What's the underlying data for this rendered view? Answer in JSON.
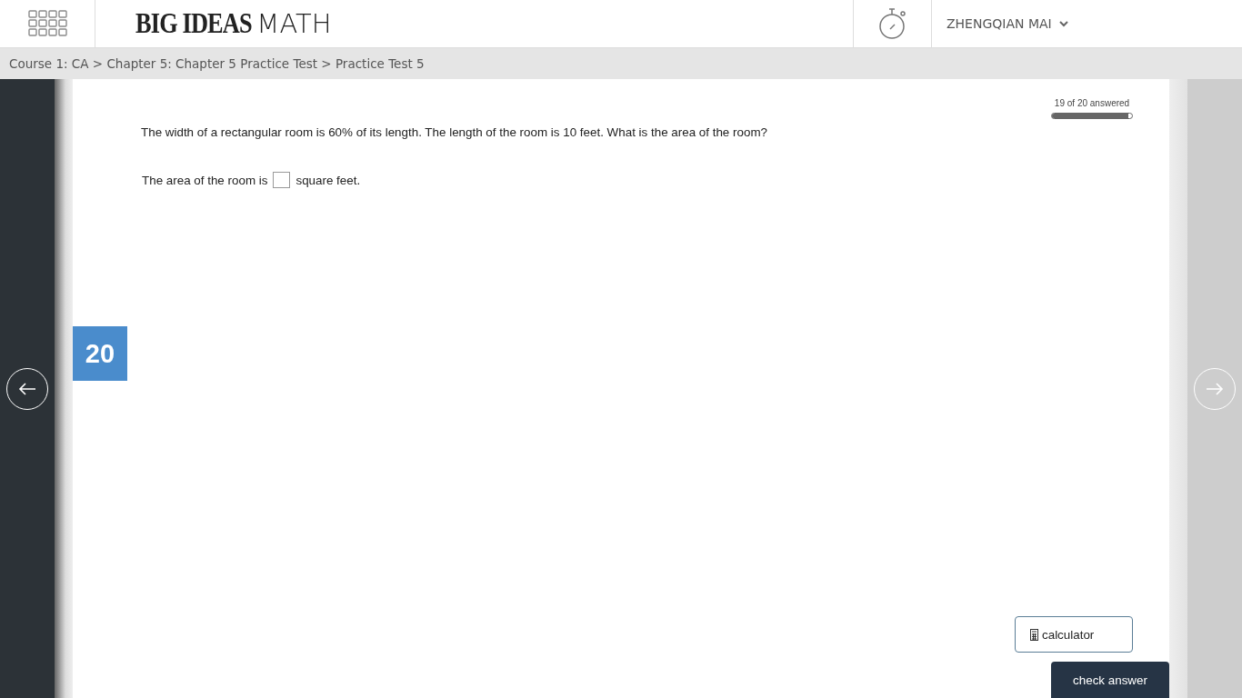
{
  "header": {
    "logo_primary": "BIG IDEAS",
    "logo_secondary": "MATH",
    "user": "ZHENGQIAN MAI"
  },
  "breadcrumb": "Course 1: CA > Chapter 5: Chapter 5 Practice Test > Practice Test 5",
  "progress": {
    "label": "19 of 20 answered",
    "level": 0.95
  },
  "question": {
    "number": "20",
    "prompt": "The width of a rectangular room is 60% of its length. The length of the room is 10 feet. What is the area of the room?",
    "answer_before": "The area of the room is",
    "answer_after": "square feet."
  },
  "buttons": {
    "calculator": "calculator",
    "check": "check answer"
  }
}
